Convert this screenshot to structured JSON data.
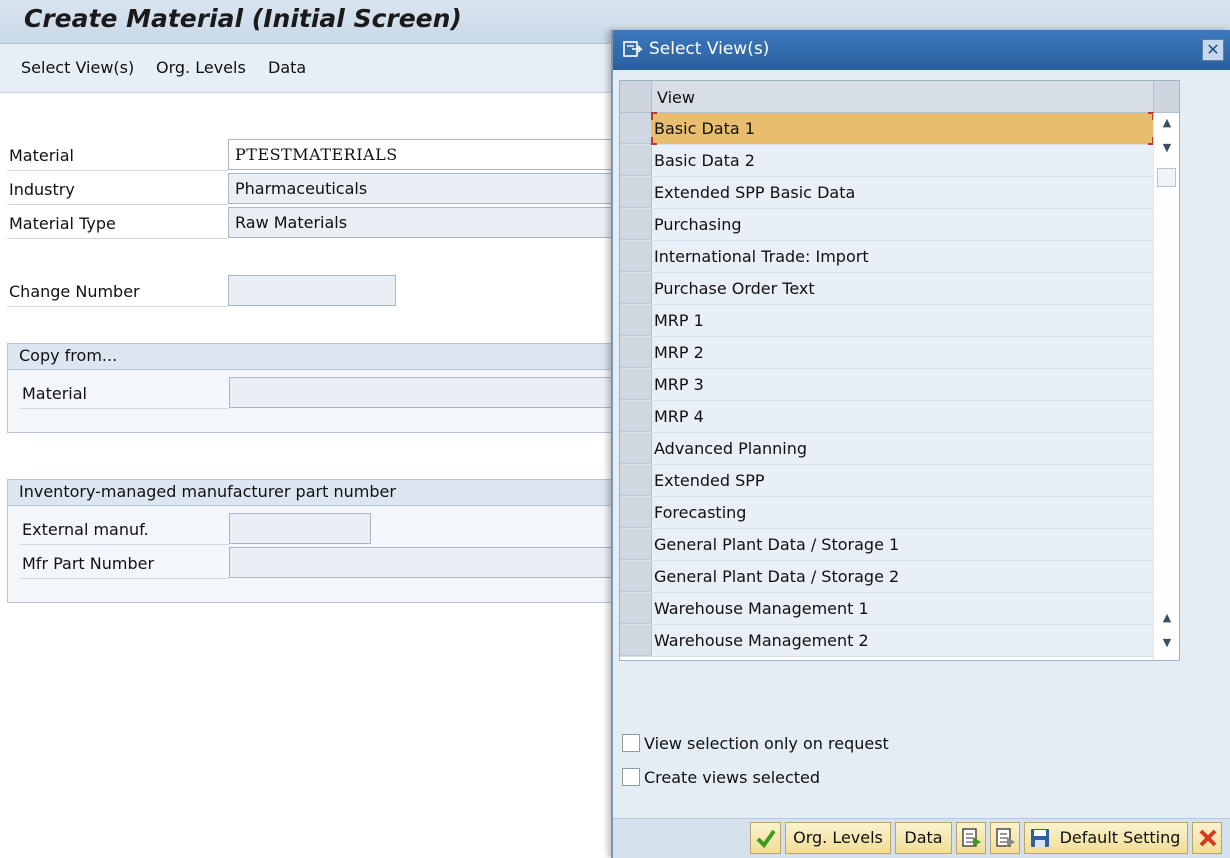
{
  "window": {
    "title": "Create Material (Initial Screen)"
  },
  "menu": [
    "Select View(s)",
    "Org. Levels",
    "Data"
  ],
  "form": {
    "material": {
      "label": "Material",
      "value": "PTESTMATERIALS"
    },
    "industry": {
      "label": "Industry",
      "value": "Pharmaceuticals"
    },
    "material_type": {
      "label": "Material Type",
      "value": "Raw Materials"
    },
    "change_number": {
      "label": "Change Number",
      "value": ""
    }
  },
  "copy_from": {
    "title": "Copy from...",
    "material_label": "Material",
    "material_value": ""
  },
  "inventory_group": {
    "title": "Inventory-managed manufacturer part number",
    "external_manuf_label": "External manuf.",
    "mfr_part_label": "Mfr Part Number"
  },
  "dialog": {
    "title": "Select View(s)",
    "column_header": "View",
    "views": [
      "Basic Data 1",
      "Basic Data 2",
      "Extended SPP Basic Data",
      "Purchasing",
      "International Trade: Import",
      "Purchase Order Text",
      "MRP 1",
      "MRP 2",
      "MRP 3",
      "MRP 4",
      "Advanced Planning",
      "Extended SPP",
      "Forecasting",
      "General Plant Data / Storage 1",
      "General Plant Data / Storage 2",
      "Warehouse Management 1",
      "Warehouse Management 2"
    ],
    "selected_view": "Basic Data 1",
    "options": {
      "view_on_request": "View selection only on request",
      "create_selected": "Create views selected"
    },
    "buttons": {
      "org_levels": "Org. Levels",
      "data": "Data",
      "default_setting": "Default Setting"
    }
  },
  "colors": {
    "title_bar": "#3c79bd",
    "selected_row": "#e8bd6d",
    "button_face": "#f1dd95",
    "cancel": "#d9381e",
    "confirm": "#3f9a1f"
  }
}
